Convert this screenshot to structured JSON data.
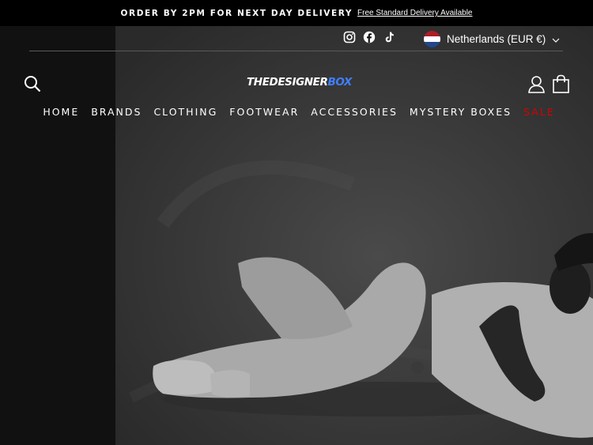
{
  "announcement": {
    "text": "ORDER BY 2PM FOR NEXT DAY DELIVERY",
    "link": "Free Standard Delivery Available"
  },
  "header": {
    "social_icons": [
      "instagram-icon",
      "facebook-icon",
      "tiktok-icon"
    ],
    "locale": {
      "label": "Netherlands (EUR €)",
      "flag": "netherlands-flag"
    },
    "logo": {
      "part1": "THEDESIGNER",
      "part2": "BOX"
    }
  },
  "nav": {
    "items": [
      "HOME",
      "BRANDS",
      "CLOTHING",
      "FOOTWEAR",
      "ACCESSORIES",
      "MYSTERY BOXES",
      "SALE"
    ]
  },
  "colors": {
    "announcement_bg": "#000000",
    "logo_accent": "#3f7fff",
    "sale": "#d80000",
    "hero_bg": "#3a3a3a"
  }
}
